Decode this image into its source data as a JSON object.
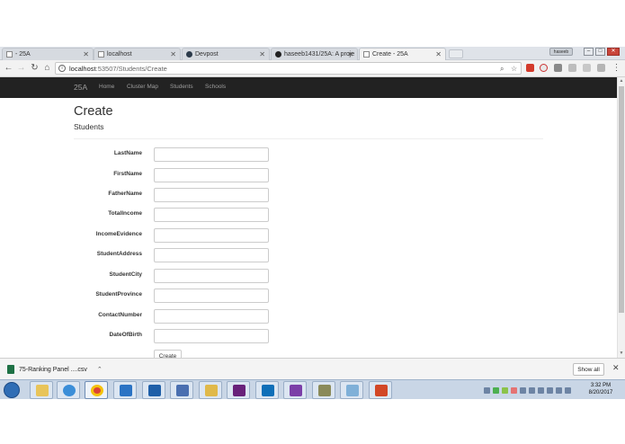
{
  "browser": {
    "tabs": [
      {
        "label": "- 25A",
        "active": false,
        "favicon": "page-icon"
      },
      {
        "label": "localhost",
        "active": false,
        "favicon": "page-icon"
      },
      {
        "label": "Devpost",
        "active": false,
        "favicon": "devpost-icon"
      },
      {
        "label": "haseeb1431/25A: A proje",
        "active": false,
        "favicon": "github-icon"
      },
      {
        "label": "Create - 25A",
        "active": true,
        "favicon": "page-icon"
      }
    ],
    "user_chip": "haseeb",
    "url_host": "localhost",
    "url_path": ":53507/Students/Create"
  },
  "navbar": {
    "brand": "25A",
    "links": [
      "Home",
      "Cluster Map",
      "Students",
      "Schools"
    ]
  },
  "page": {
    "title": "Create",
    "subtitle": "Students",
    "fields": [
      {
        "label": "LastName",
        "value": ""
      },
      {
        "label": "FirstName",
        "value": ""
      },
      {
        "label": "FatherName",
        "value": ""
      },
      {
        "label": "TotalIncome",
        "value": ""
      },
      {
        "label": "IncomeEvidence",
        "value": ""
      },
      {
        "label": "StudentAddress",
        "value": ""
      },
      {
        "label": "StudentCity",
        "value": ""
      },
      {
        "label": "StudentProvince",
        "value": ""
      },
      {
        "label": "ContactNumber",
        "value": ""
      },
      {
        "label": "DateOfBirth",
        "value": ""
      }
    ],
    "submit_label": "Create"
  },
  "download_shelf": {
    "file_name": "75-Ranking Panel ....csv",
    "show_all_label": "Show all"
  },
  "taskbar": {
    "time": "3:32 PM",
    "date": "8/20/2017",
    "apps": [
      "explorer-icon",
      "ie-icon",
      "chrome-icon",
      "lync-icon",
      "outlook-icon",
      "network-icon",
      "android-icon",
      "vs-icon",
      "vscode-icon",
      "vs-purple-icon",
      "sql-icon",
      "paint-icon",
      "powerpoint-icon"
    ]
  },
  "colors": {
    "navbar_bg": "#222222",
    "navbar_text": "#9d9d9d",
    "taskbar_bg": "#c9d6e6"
  }
}
